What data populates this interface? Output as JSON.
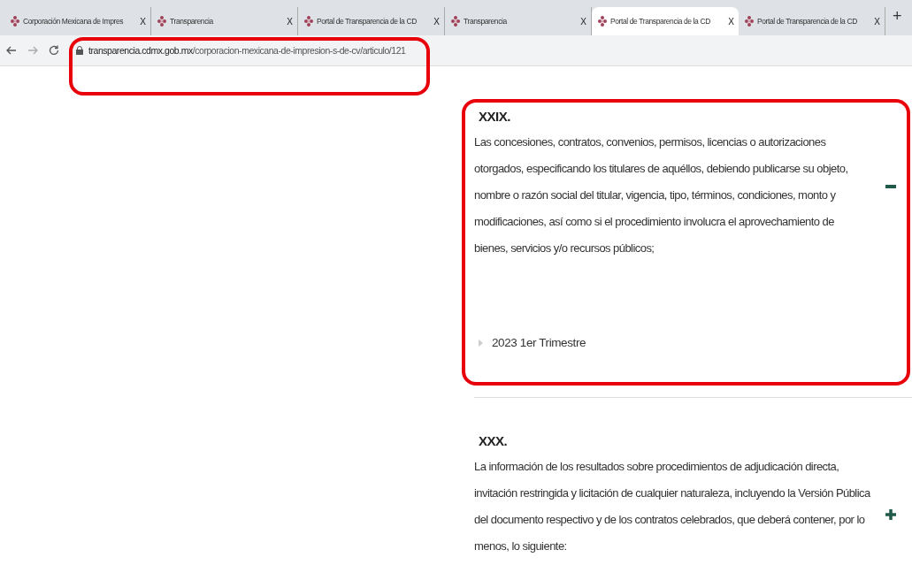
{
  "tabs": [
    {
      "title": "Corporación Mexicana de Impres",
      "selected": false
    },
    {
      "title": "Transparencia",
      "selected": false
    },
    {
      "title": "Portal de Transparencia de la CD",
      "selected": false
    },
    {
      "title": "Transparencia",
      "selected": false
    },
    {
      "title": "Portal de Transparencia de la CD",
      "selected": true
    },
    {
      "title": "Portal de Transparencia de la CD",
      "selected": false
    }
  ],
  "tab_close": [
    "X",
    "X",
    "X",
    "X",
    "X",
    "X"
  ],
  "new_tab": "+",
  "address_bar": {
    "domain": "transparencia.cdmx.gob.mx",
    "path": "/corporacion-mexicana-de-impresion-s-de-cv/articulo/121"
  },
  "sections": [
    {
      "numeral": "XXIX.",
      "text": "Las concesiones, contratos, convenios, permisos, licencias o autorizaciones otorgados, especificando los titulares de aquéllos, debiendo publicarse su objeto, nombre o razón social del titular, vigencia, tipo, términos, condiciones, monto y modificaciones, así como si el procedimiento involucra el aprovechamiento de bienes, servicios y/o recursos públicos;",
      "expanded": true,
      "items": [
        "2023 1er Trimestre"
      ]
    },
    {
      "numeral": "XXX.",
      "text": "La información de los resultados sobre procedimientos de adjudicación directa, invitación restringida y licitación de cualquier naturaleza, incluyendo la Versión Pública del documento respectivo y de los contratos celebrados, que deberá contener, por lo menos, lo siguiente:",
      "expanded": false
    }
  ]
}
